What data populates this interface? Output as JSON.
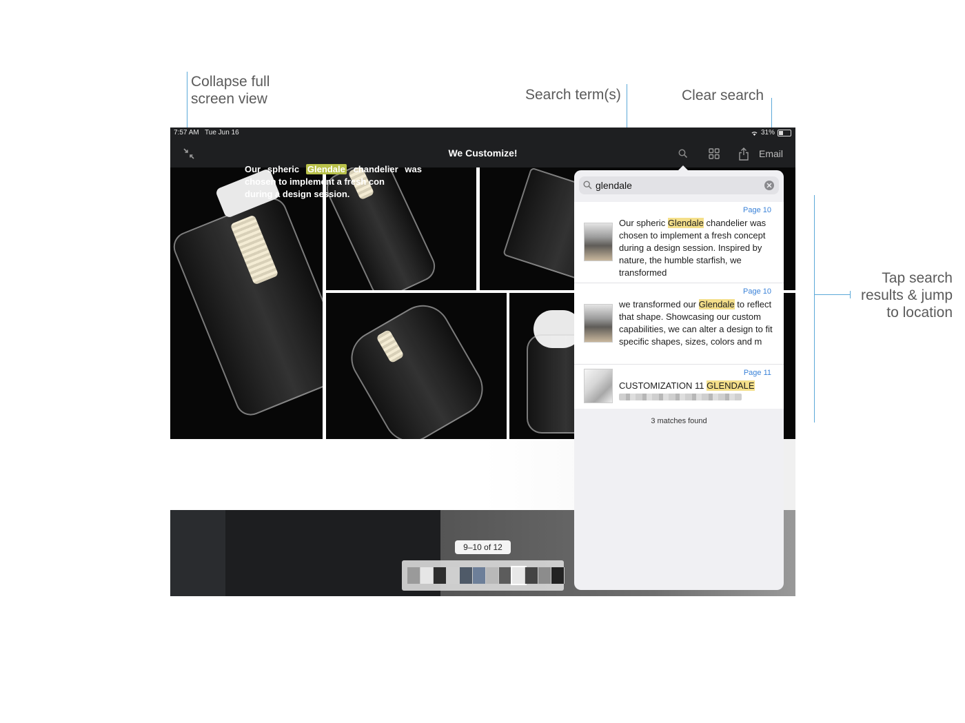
{
  "annotations": {
    "collapse": [
      "Collapse full",
      "screen view"
    ],
    "search_terms": "Search term(s)",
    "clear_search": "Clear search",
    "tap_results": [
      "Tap search",
      "results & jump",
      "to location"
    ]
  },
  "status_bar": {
    "time": "7:57 AM",
    "date": "Tue Jun 16",
    "battery": "31%",
    "battery_level": 0.31
  },
  "nav": {
    "title": "We Customize!",
    "collapse_icon": "collapse-arrows-icon",
    "search_icon": "search-icon",
    "grid_icon": "grid-icon",
    "share_icon": "share-icon",
    "email_label": "Email"
  },
  "banner": {
    "quote_pre": "Our spheric ",
    "quote_highlight": "Glendale",
    "quote_post": " chandelier was chosen to implement a fresh con",
    "quote_line3": "during a design session.",
    "page_indicator": "9–10 of 12"
  },
  "search": {
    "query": "glendale",
    "matches_text": "3 matches found",
    "results": [
      {
        "page": "Page 10",
        "pre": "Our spheric ",
        "hl": "Glendale",
        "post": " chandelier was chosen to implement a fresh concept during a design session. Inspired by nature, the humble starfish, we transformed"
      },
      {
        "page": "Page 10",
        "pre": "we transformed our ",
        "hl": "Glendale",
        "post": " to reflect that shape. Showcasing our custom capabilities, we can alter a design to fit specific shapes, sizes, colors and m"
      },
      {
        "page": "Page 11",
        "pre": "CUSTOMIZATION 11 ",
        "hl": "GLENDALE",
        "post": ""
      }
    ]
  },
  "colors": {
    "accent": "#3a82d8",
    "highlight": "#f4df8a",
    "toolbar": "#1e1f21"
  }
}
